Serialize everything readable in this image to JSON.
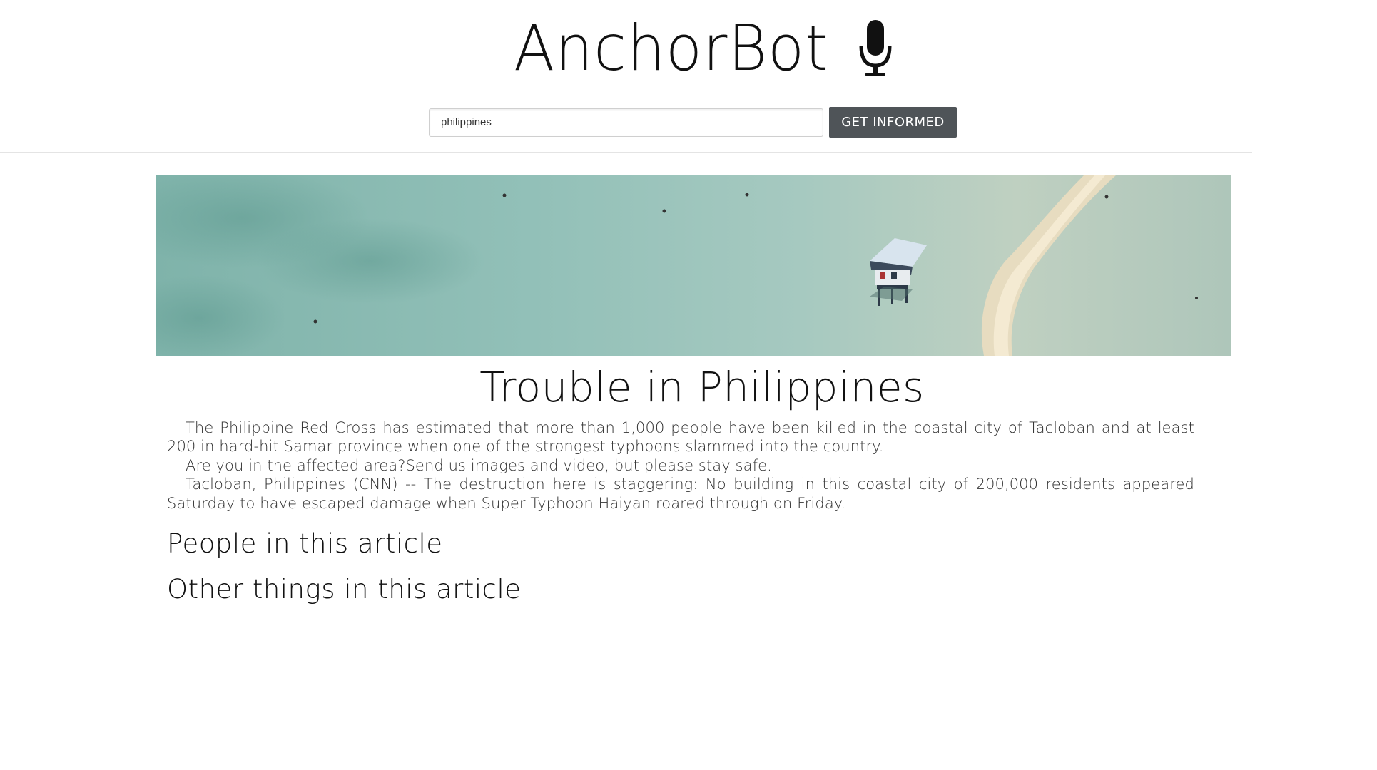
{
  "header": {
    "logo_text": "AnchorBot",
    "logo_icon": "microphone-icon"
  },
  "search": {
    "value": "philippines",
    "button_label": "GET INFORMED"
  },
  "hero": {
    "image_description_icon": "beach-hut-aerial-image"
  },
  "article": {
    "title": "Trouble in Philippines",
    "paragraphs": [
      "The Philippine Red Cross has estimated that more than 1,000 people have been killed in the coastal city of Tacloban and at least 200 in hard-hit Samar province when one of the strongest typhoons slammed into the country.",
      "Are you in the affected area?Send us images and video, but please stay safe.",
      "Tacloban, Philippines (CNN) -- The destruction here is staggering: No building in this coastal city of 200,000 residents appeared Saturday to have escaped damage when Super Typhoon Haiyan roared through on Friday."
    ],
    "people_heading": "People in this article",
    "other_heading": "Other things in this article"
  }
}
